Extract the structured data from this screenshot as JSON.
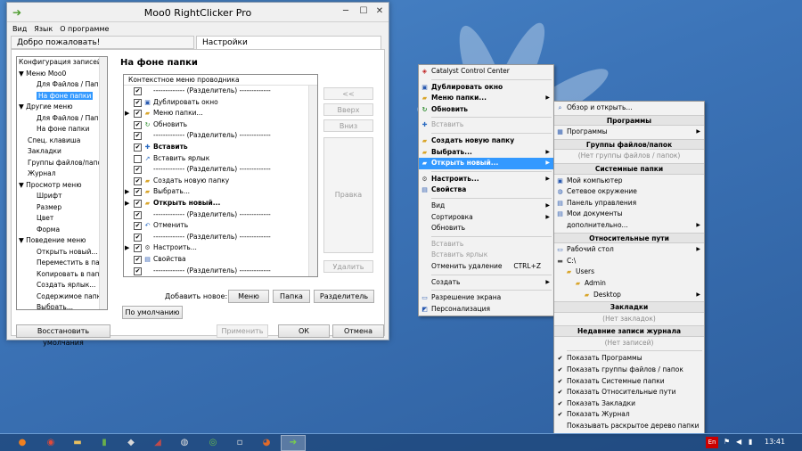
{
  "window": {
    "title": "Moo0 RightClicker Pro",
    "menu": [
      "Вид",
      "Язык",
      "О программе"
    ],
    "tabs": [
      "Добро пожаловать!",
      "Настройки"
    ],
    "tree": [
      {
        "label": "Конфигурация записей",
        "indent": 0
      },
      {
        "label": "▼ Меню Moo0",
        "indent": 0
      },
      {
        "label": "Для Файлов / Папки",
        "indent": 2
      },
      {
        "label": "На фоне папки",
        "indent": 2,
        "selected": true
      },
      {
        "label": "▼ Другие меню",
        "indent": 0
      },
      {
        "label": "Для Файлов / Папки",
        "indent": 2
      },
      {
        "label": "На фоне папки",
        "indent": 2
      },
      {
        "label": "Спец. клавиша",
        "indent": 1
      },
      {
        "label": "Закладки",
        "indent": 1
      },
      {
        "label": "Группы файлов/папок",
        "indent": 1
      },
      {
        "label": "Журнал",
        "indent": 1
      },
      {
        "label": "▼ Просмотр меню",
        "indent": 0
      },
      {
        "label": "Шрифт",
        "indent": 2
      },
      {
        "label": "Размер",
        "indent": 2
      },
      {
        "label": "Цвет",
        "indent": 2
      },
      {
        "label": "Форма",
        "indent": 2
      },
      {
        "label": "▼ Поведение меню",
        "indent": 0
      },
      {
        "label": "Открыть новый...",
        "indent": 2
      },
      {
        "label": "Переместить в папку...",
        "indent": 2
      },
      {
        "label": "Копировать в папку...",
        "indent": 2
      },
      {
        "label": "Создать ярлык...",
        "indent": 2
      },
      {
        "label": "Содержимое папки...",
        "indent": 2
      },
      {
        "label": "Выбрать...",
        "indent": 2
      }
    ],
    "section_title": "На фоне папки",
    "list_header": "Контекстное меню проводника",
    "list": [
      {
        "text": "------------- (Разделитель) -------------",
        "checked": true,
        "arrow": false,
        "icon": "",
        "bold": false
      },
      {
        "text": "Дублировать окно",
        "checked": true,
        "arrow": false,
        "icon": "window-icon",
        "bold": false
      },
      {
        "text": "Меню папки...",
        "checked": true,
        "arrow": true,
        "icon": "folder-icon",
        "bold": false
      },
      {
        "text": "Обновить",
        "checked": true,
        "arrow": false,
        "icon": "refresh-icon",
        "bold": false
      },
      {
        "text": "------------- (Разделитель) -------------",
        "checked": true,
        "arrow": false,
        "icon": "",
        "bold": false
      },
      {
        "text": "Вставить",
        "checked": true,
        "arrow": false,
        "icon": "paste-icon",
        "bold": true
      },
      {
        "text": "Вставить ярлык",
        "checked": false,
        "arrow": false,
        "icon": "shortcut-icon",
        "bold": false
      },
      {
        "text": "------------- (Разделитель) -------------",
        "checked": true,
        "arrow": false,
        "icon": "",
        "bold": false
      },
      {
        "text": "Создать новую папку",
        "checked": true,
        "arrow": false,
        "icon": "new-folder-icon",
        "bold": false
      },
      {
        "text": "Выбрать...",
        "checked": true,
        "arrow": true,
        "icon": "folder-icon",
        "bold": false
      },
      {
        "text": "Открыть новый...",
        "checked": true,
        "arrow": true,
        "icon": "folder-icon",
        "bold": true
      },
      {
        "text": "------------- (Разделитель) -------------",
        "checked": true,
        "arrow": false,
        "icon": "",
        "bold": false
      },
      {
        "text": "Отменить",
        "checked": true,
        "arrow": false,
        "icon": "undo-icon",
        "bold": false
      },
      {
        "text": "------------- (Разделитель) -------------",
        "checked": true,
        "arrow": false,
        "icon": "",
        "bold": false
      },
      {
        "text": "Настроить...",
        "checked": true,
        "arrow": true,
        "icon": "settings-icon",
        "bold": false
      },
      {
        "text": "Свойства",
        "checked": true,
        "arrow": false,
        "icon": "properties-icon",
        "bold": false
      },
      {
        "text": "------------- (Разделитель) -------------",
        "checked": true,
        "arrow": false,
        "icon": "",
        "bold": false
      }
    ],
    "side_buttons": {
      "move_up": "<<",
      "up": "Вверх",
      "down": "Вниз",
      "edit": "Правка",
      "delete": "Удалить"
    },
    "add_new_label": "Добавить новое:",
    "add_buttons": {
      "menu": "Меню",
      "folder": "Папка",
      "separator": "Разделитель"
    },
    "default_button": "По умолчанию",
    "restore_button": "Восстановить умолчания",
    "apply_button": "Применить",
    "ok_button": "ОК",
    "cancel_button": "Отмена"
  },
  "context_menu": [
    {
      "type": "item",
      "text": "Catalyst Control Center",
      "icon": "catalyst-icon"
    },
    {
      "type": "sep"
    },
    {
      "type": "item",
      "text": "Дублировать окно",
      "bold": true,
      "icon": "window-icon"
    },
    {
      "type": "item",
      "text": "Меню папки...",
      "bold": true,
      "sub": true,
      "icon": "folder-icon"
    },
    {
      "type": "item",
      "text": "Обновить",
      "bold": true,
      "icon": "refresh-icon"
    },
    {
      "type": "sep"
    },
    {
      "type": "item",
      "text": "Вставить",
      "disabled": true,
      "icon": "paste-icon"
    },
    {
      "type": "sep"
    },
    {
      "type": "item",
      "text": "Создать новую папку",
      "bold": true,
      "icon": "new-folder-icon"
    },
    {
      "type": "item",
      "text": "Выбрать...",
      "bold": true,
      "sub": true,
      "icon": "folder-icon"
    },
    {
      "type": "item",
      "text": "Открыть новый...",
      "bold": true,
      "sub": true,
      "highlight": true,
      "icon": "folder-icon"
    },
    {
      "type": "sep"
    },
    {
      "type": "item",
      "text": "Настроить...",
      "bold": true,
      "sub": true,
      "icon": "settings-icon"
    },
    {
      "type": "item",
      "text": "Свойства",
      "bold": true,
      "icon": "properties-icon"
    },
    {
      "type": "sep"
    },
    {
      "type": "item",
      "text": "Вид",
      "sub": true
    },
    {
      "type": "item",
      "text": "Сортировка",
      "sub": true
    },
    {
      "type": "item",
      "text": "Обновить"
    },
    {
      "type": "sep"
    },
    {
      "type": "item",
      "text": "Вставить",
      "disabled": true
    },
    {
      "type": "item",
      "text": "Вставить ярлык",
      "disabled": true
    },
    {
      "type": "item",
      "text": "Отменить удаление",
      "kb": "CTRL+Z"
    },
    {
      "type": "sep"
    },
    {
      "type": "item",
      "text": "Создать",
      "sub": true
    },
    {
      "type": "sep"
    },
    {
      "type": "item",
      "text": "Разрешение экрана",
      "icon": "display-icon"
    },
    {
      "type": "item",
      "text": "Персонализация",
      "icon": "personalize-icon"
    }
  ],
  "submenu": [
    {
      "type": "item",
      "text": "Обзор и открыть...",
      "icon": "browse-icon"
    },
    {
      "type": "hdr",
      "text": "Программы"
    },
    {
      "type": "item",
      "text": "Программы",
      "sub": true,
      "icon": "programs-icon"
    },
    {
      "type": "hdr",
      "text": "Группы файлов/папок"
    },
    {
      "type": "gray",
      "text": "(Нет группы файлов / папок)"
    },
    {
      "type": "hdr",
      "text": "Системные папки"
    },
    {
      "type": "item",
      "text": "Мой компьютер",
      "icon": "computer-icon"
    },
    {
      "type": "item",
      "text": "Сетевое окружение",
      "icon": "network-icon"
    },
    {
      "type": "item",
      "text": "Панель управления",
      "icon": "control-panel-icon"
    },
    {
      "type": "item",
      "text": "Мои документы",
      "icon": "documents-icon"
    },
    {
      "type": "item",
      "text": "дополнительно...",
      "sub": true
    },
    {
      "type": "hdr",
      "text": "Относительные пути"
    },
    {
      "type": "item",
      "text": "Рабочий стол",
      "sub": true,
      "icon": "desktop-icon"
    },
    {
      "type": "item",
      "text": "C:\\",
      "icon": "drive-icon"
    },
    {
      "type": "item",
      "text": "Users",
      "icon": "folder-icon",
      "indent": 1
    },
    {
      "type": "item",
      "text": "Admin",
      "icon": "folder-icon",
      "indent": 2
    },
    {
      "type": "item",
      "text": "Desktop",
      "sub": true,
      "icon": "folder-icon",
      "indent": 3
    },
    {
      "type": "hdr",
      "text": "Закладки"
    },
    {
      "type": "gray",
      "text": "(Нет закладок)"
    },
    {
      "type": "hdr",
      "text": "Недавние записи журнала"
    },
    {
      "type": "gray",
      "text": "(Нет записей)"
    },
    {
      "type": "sep"
    },
    {
      "type": "item",
      "text": "Показать Программы",
      "check": true
    },
    {
      "type": "item",
      "text": "Показать группы файлов / папок",
      "check": true
    },
    {
      "type": "item",
      "text": "Показать Системные папки",
      "check": true
    },
    {
      "type": "item",
      "text": "Показать Относительные пути",
      "check": true
    },
    {
      "type": "item",
      "text": "Показать Закладки",
      "check": true
    },
    {
      "type": "item",
      "text": "Показать Журнал",
      "check": true
    },
    {
      "type": "item",
      "text": "Показывать раскрытое дерево папки",
      "check": false
    }
  ],
  "taskbar": {
    "lang": "En",
    "time": "13:41"
  }
}
